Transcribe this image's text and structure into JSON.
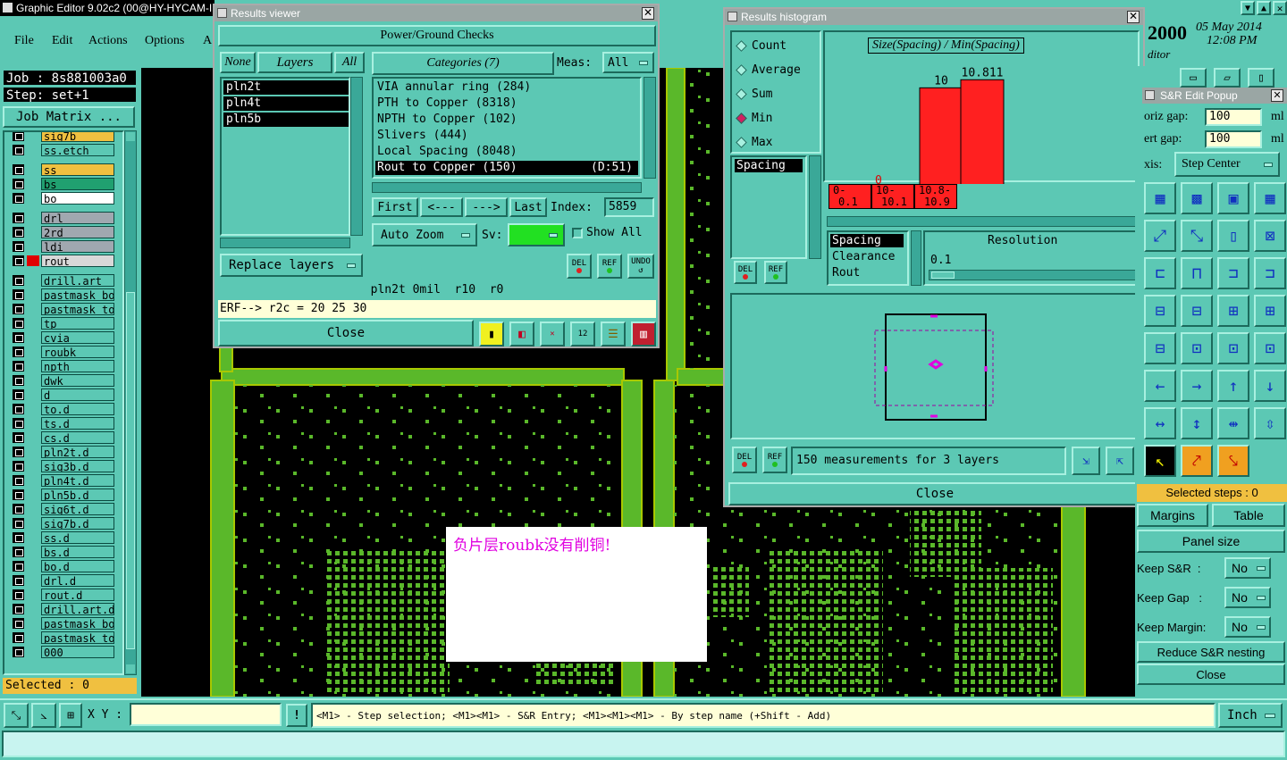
{
  "main": {
    "title": "Graphic Editor 9.02c2 (00@HY-HYCAM-I",
    "menu": [
      "File",
      "Edit",
      "Actions",
      "Options",
      "A"
    ],
    "job": "Job : 8s881003a0",
    "step": "Step: set+1",
    "job_matrix": "Job Matrix ...",
    "layers": [
      "sig7b",
      "ss.etch",
      "ss",
      "bs",
      "bo",
      "drl",
      "2rd",
      "ldi",
      "rout",
      "drill.art",
      "pastmask_bot",
      "pastmask_top",
      "tp",
      "cvia",
      "roubk",
      "npth",
      "dwk",
      "d",
      "to.d",
      "ts.d",
      "cs.d",
      "pln2t.d",
      "sig3b.d",
      "pln4t.d",
      "pln5b.d",
      "sig6t.d",
      "sig7b.d",
      "ss.d",
      "bs.d",
      "bo.d",
      "drl.d",
      "rout.d",
      "drill.art.d",
      "pastmask_bot",
      "pastmask_top",
      "000"
    ],
    "selected": "Selected : 0",
    "xy_label": "X Y :",
    "xy_value": "",
    "status_hint": "<M1> - Step selection; <M1><M1> - S&R Entry; <M1><M1><M1> - By step name (+Shift - Add)",
    "units": "Inch",
    "annotation": "负片层roubk没有削铜!",
    "clock_year": "2000",
    "clock_date": "05 May 2014",
    "clock_time": "12:08 PM",
    "clock_sub": "ditor"
  },
  "results_viewer": {
    "title": "Results viewer",
    "header": "Power/Ground Checks",
    "none": "None",
    "layers_btn": "Layers",
    "all": "All",
    "layers": [
      "pln2t",
      "pln4t",
      "pln5b"
    ],
    "categories_btn": "Categories (7)",
    "meas_label": "Meas:",
    "meas_value": "All",
    "categories": [
      {
        "label": "VIA annular ring (284)",
        "extra": ""
      },
      {
        "label": "PTH to Copper (8318)",
        "extra": ""
      },
      {
        "label": "NPTH to Copper (102)",
        "extra": ""
      },
      {
        "label": "Slivers (444)",
        "extra": ""
      },
      {
        "label": "Local Spacing (8048)",
        "extra": ""
      },
      {
        "label": "Rout to Copper (150)",
        "extra": "(D:51)"
      }
    ],
    "first": "First",
    "prev": "<---",
    "next": "--->",
    "last": "Last",
    "index_label": "Index:",
    "index_value": "5859",
    "auto_zoom": "Auto Zoom",
    "sv_label": "Sv:",
    "show_all": "Show All",
    "replace_layers": "Replace layers",
    "del": "DEL",
    "ref": "REF",
    "undo": "UNDO",
    "status1": "pln2t 0mil  r10  r0",
    "status2": "ERF--> r2c = 20 25 30",
    "close": "Close"
  },
  "histogram": {
    "title": "Results histogram",
    "stats": [
      "Count",
      "Average",
      "Sum",
      "Min",
      "Max"
    ],
    "stat_selected": "Min",
    "chart_title": "Size(Spacing) / Min(Spacing)",
    "list1": [
      "Spacing"
    ],
    "bins": [
      {
        "range_top": "0-",
        "range_bot": "0.1",
        "value": "0"
      },
      {
        "range_top": "10-",
        "range_bot": "10.1",
        "value": "10"
      },
      {
        "range_top": "10.8-",
        "range_bot": "10.9",
        "value": "10.811"
      }
    ],
    "bar_values": [
      0,
      10,
      10.811
    ],
    "list2": [
      "Spacing",
      "Clearance",
      "Rout"
    ],
    "resolution_label": "Resolution",
    "resolution_value": "0.1",
    "measurements": "150 measurements for 3 layers",
    "close": "Close",
    "del": "DEL",
    "ref": "REF"
  },
  "sr": {
    "title": "S&R Edit Popup",
    "horiz_label": "oriz gap:",
    "horiz_value": "100",
    "vert_label": "ert  gap:",
    "vert_value": "100",
    "unit": "ml",
    "axis_label": "xis:",
    "axis_value": "Step Center",
    "selected_steps": "Selected steps : 0",
    "margins": "Margins",
    "table": "Table",
    "panel_size": "Panel size",
    "keep_sr": "Keep S&R  :",
    "keep_gap": "Keep Gap   :",
    "keep_margin": "Keep Margin:",
    "no": "No",
    "reduce": "Reduce S&R nesting",
    "close": "Close"
  },
  "colors": {
    "panel": "#5cc8b4",
    "dark_panel": "#1c6a5c",
    "copper": "#5ab82a",
    "frame": "#a8c800",
    "bar": "#ff2020",
    "annotation": "#e000e0"
  }
}
